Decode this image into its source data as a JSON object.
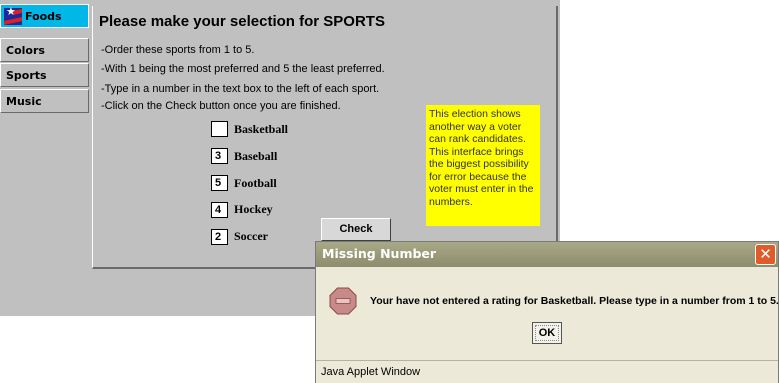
{
  "tabs": [
    {
      "label": "Foods",
      "active": true,
      "icon": "flag-icon"
    },
    {
      "label": "Colors",
      "active": false
    },
    {
      "label": "Sports",
      "active": false
    },
    {
      "label": "Music",
      "active": false
    }
  ],
  "main": {
    "title": "Please make your selection for SPORTS",
    "instructions": [
      "-Order these sports from 1 to 5.",
      "-With 1 being the most preferred and 5 the least preferred.",
      "-Type in a number in the text box to the left of each sport.",
      "-Click on the Check button once you are finished."
    ],
    "sports": [
      {
        "label": "Basketball",
        "value": ""
      },
      {
        "label": "Baseball",
        "value": "3"
      },
      {
        "label": "Football",
        "value": "5"
      },
      {
        "label": "Hockey",
        "value": "4"
      },
      {
        "label": "Soccer",
        "value": "2"
      }
    ],
    "note": "This election shows another way a voter can rank candidates. This interface brings the biggest possibility for error because the voter must enter in the numbers.",
    "check_label": "Check"
  },
  "dialog": {
    "title": "Missing Number",
    "close_glyph": "✕",
    "icon": "stop-icon",
    "message": "Your have not entered a rating for Basketball. Please type in a number from 1 to 5.",
    "ok_label": "OK",
    "footer": "Java Applet Window"
  },
  "colors": {
    "applet_bg": "#c0c0c0",
    "active_tab": "#00b7e8",
    "note_bg": "#ffff00",
    "dialog_titlebar": "#9d9c7c",
    "close_button": "#e05a2a"
  }
}
